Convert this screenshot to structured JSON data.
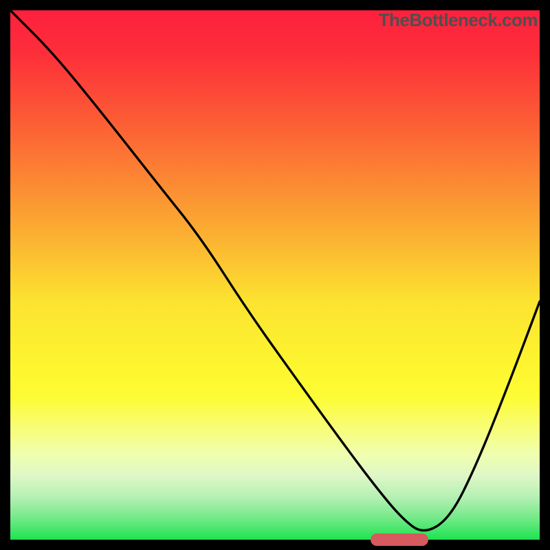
{
  "watermark": "TheBottleneck.com",
  "chart_data": {
    "type": "line",
    "title": "",
    "xlabel": "",
    "ylabel": "",
    "xlim": [
      0,
      100
    ],
    "ylim": [
      0,
      100
    ],
    "grid": false,
    "curve": {
      "x": [
        0,
        8,
        17,
        28,
        36,
        45,
        55,
        63,
        69,
        74,
        78,
        83,
        88,
        94,
        100
      ],
      "y": [
        100,
        92,
        81,
        67,
        57,
        43,
        29,
        18,
        10,
        4,
        1,
        4,
        14,
        29,
        45
      ]
    },
    "sweet_spot": {
      "x_start": 68,
      "x_end": 79,
      "y": 0
    },
    "gradient_stops": [
      {
        "pct": 0,
        "color": "#fd203e"
      },
      {
        "pct": 20,
        "color": "#fc5935"
      },
      {
        "pct": 40,
        "color": "#fba632"
      },
      {
        "pct": 55,
        "color": "#fce330"
      },
      {
        "pct": 73,
        "color": "#fdfc34"
      },
      {
        "pct": 88,
        "color": "#def7c6"
      },
      {
        "pct": 100,
        "color": "#1de351"
      }
    ]
  }
}
